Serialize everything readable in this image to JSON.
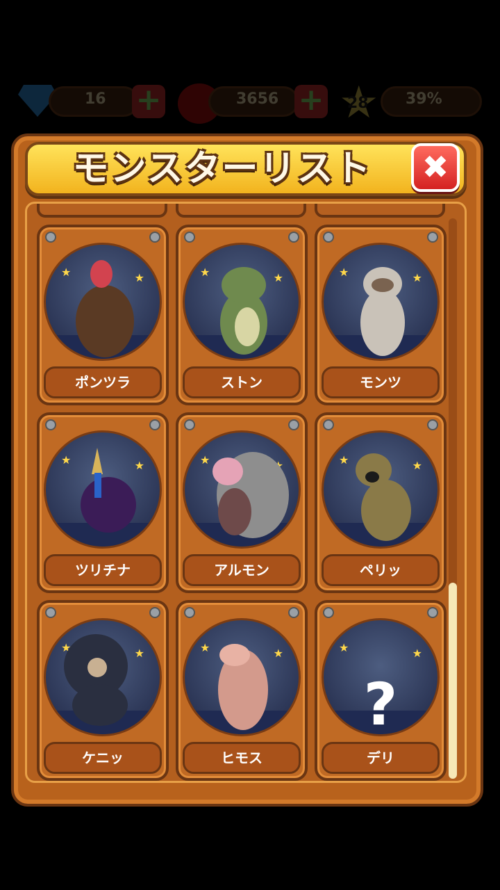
{
  "hud": {
    "gems": "16",
    "apples": "3656",
    "level": "28",
    "progress": "39%"
  },
  "dialog": {
    "title": "モンスターリスト"
  },
  "monsters": [
    {
      "name": "ポンツラ",
      "revealed": true,
      "color": "#5a3a24"
    },
    {
      "name": "ストン",
      "revealed": true,
      "color": "#6f8a4e"
    },
    {
      "name": "モンツ",
      "revealed": true,
      "color": "#c9c2b8"
    },
    {
      "name": "ツリチナ",
      "revealed": true,
      "color": "#3b1c57"
    },
    {
      "name": "アルモン",
      "revealed": true,
      "color": "#8e8e8e"
    },
    {
      "name": "ペリッ",
      "revealed": true,
      "color": "#8a7a48"
    },
    {
      "name": "ケニッ",
      "revealed": true,
      "color": "#2a2f40"
    },
    {
      "name": "ヒモス",
      "revealed": true,
      "color": "#d39a8c"
    },
    {
      "name": "デリ",
      "revealed": false,
      "color": "#ffffff"
    }
  ],
  "locked_symbol": "?",
  "close_symbol": "✖",
  "star_symbol": "★",
  "plus_symbol": "+",
  "scroll": {
    "position": 1.0
  }
}
